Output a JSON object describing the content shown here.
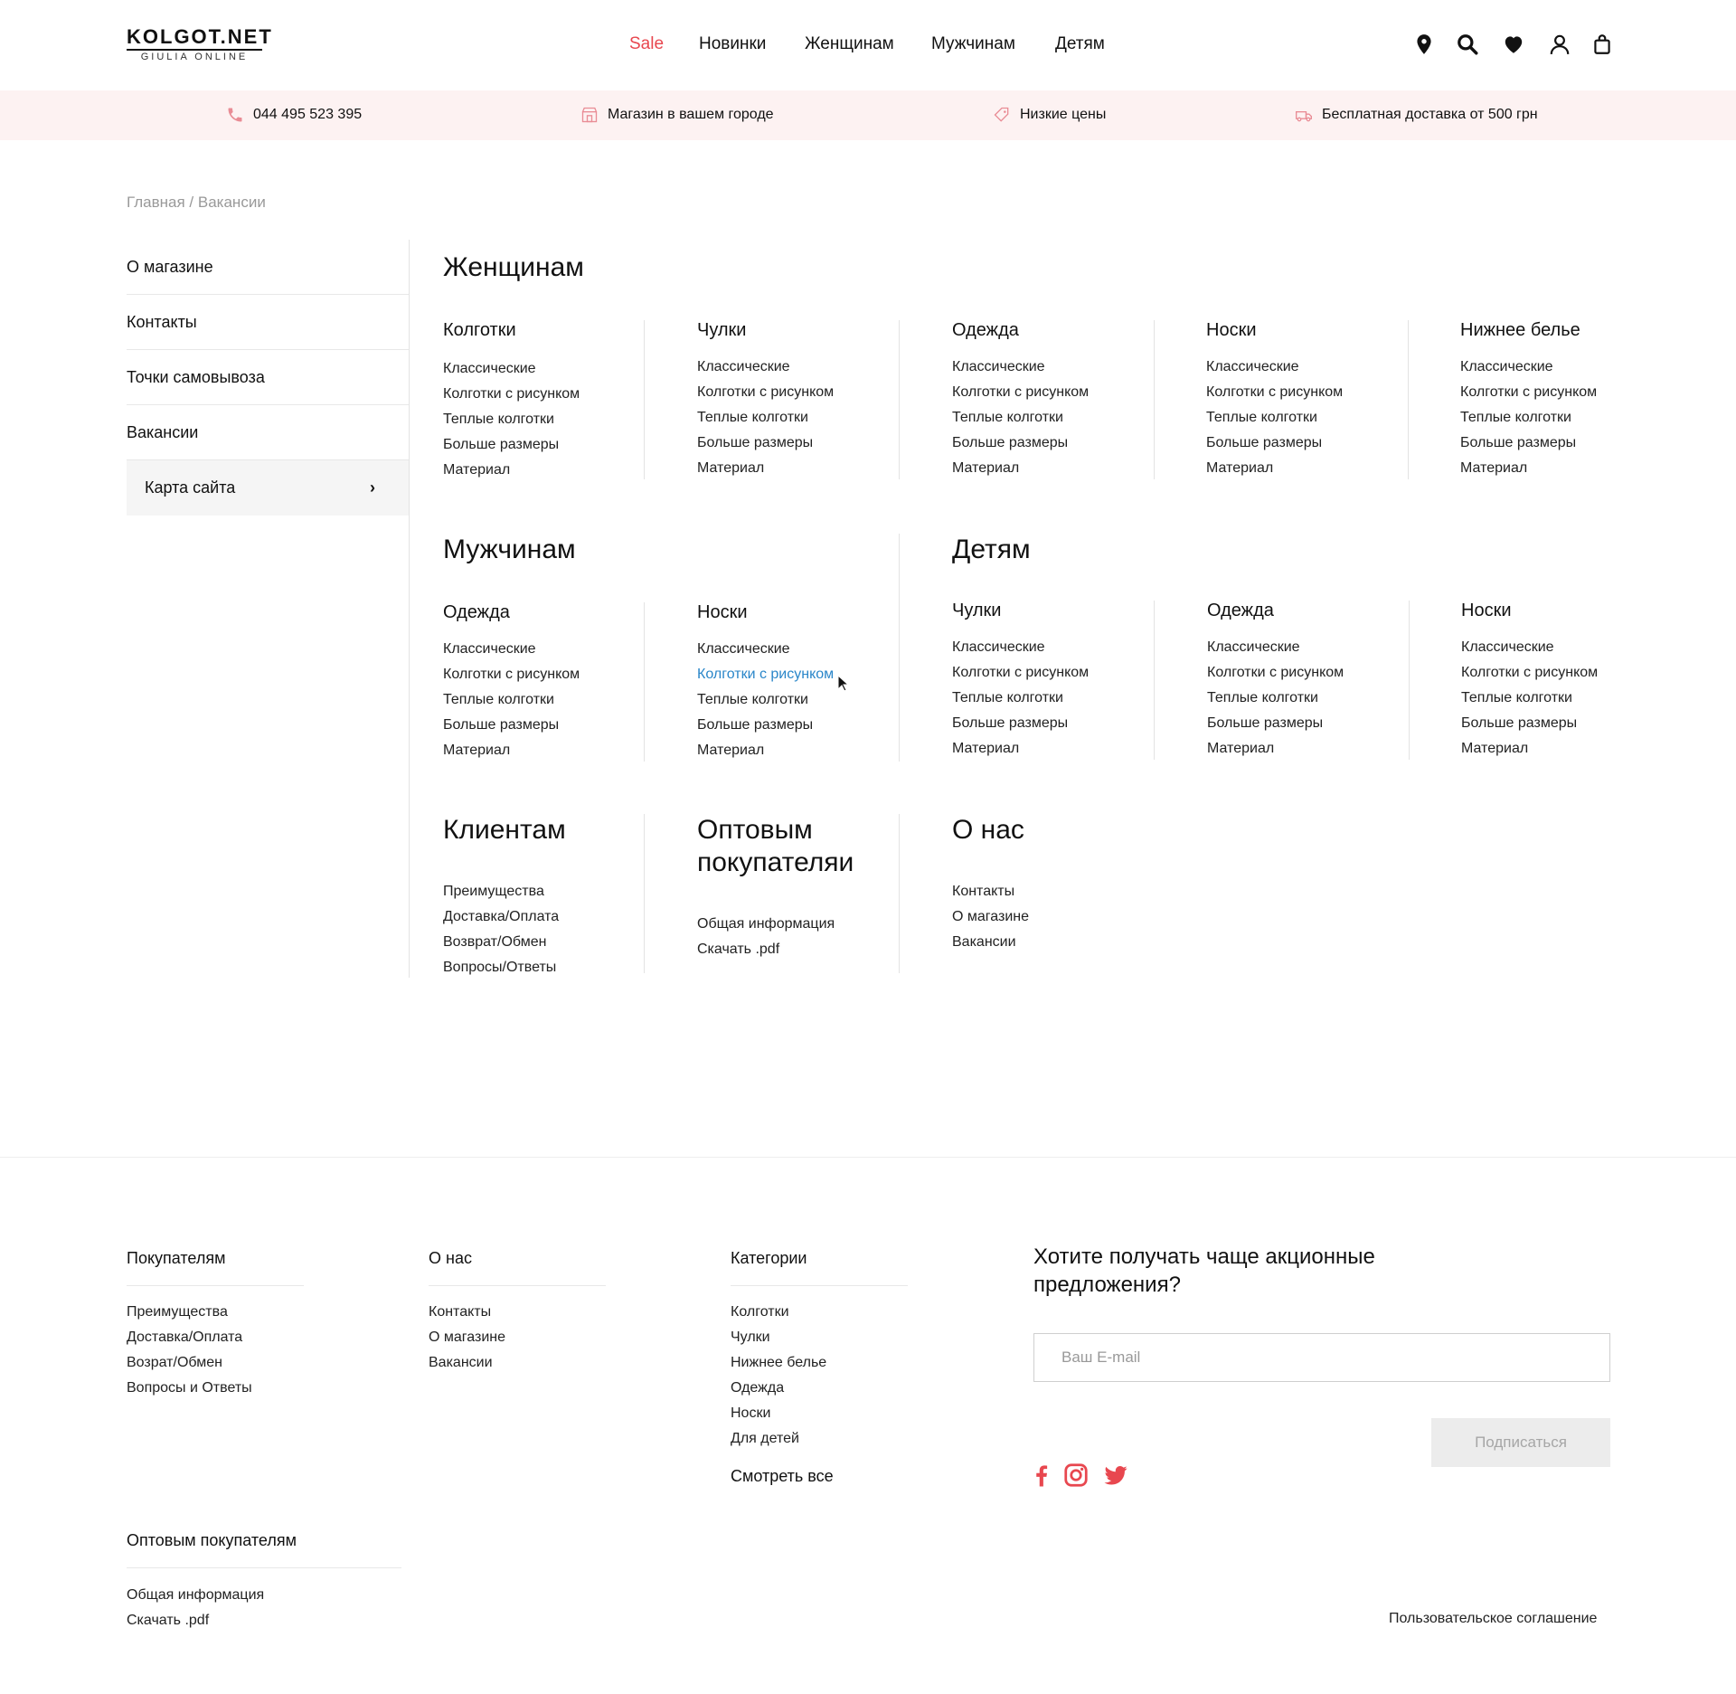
{
  "header": {
    "logo_main": "KOLGOT.NET",
    "logo_sub": "GIULIA ONLINE",
    "nav": [
      "Sale",
      "Новинки",
      "Женщинам",
      "Мужчинам",
      "Детям"
    ],
    "icons": [
      "location-icon",
      "search-icon",
      "heart-icon",
      "user-icon",
      "bag-icon"
    ]
  },
  "infobar": {
    "phone": "044 495 523 395",
    "store": "Магазин в вашем городе",
    "prices": "Низкие цены",
    "delivery": "Бесплатная доставка от 500 грн"
  },
  "breadcrumb": "Главная / Вакансии",
  "sidebar": {
    "items": [
      "О магазине",
      "Контакты",
      "Точки самовывоза",
      "Вакансии",
      "Карта сайта"
    ],
    "active_chevron": "›"
  },
  "sitemap": {
    "women": {
      "title": "Женщинам",
      "columns": [
        {
          "title": "Колготки",
          "items": [
            "Классические",
            "Колготки с рисунком",
            "Теплые колготки",
            "Больше размеры",
            "Материал"
          ]
        },
        {
          "title": "Чулки",
          "items": [
            "Классические",
            "Колготки с рисунком",
            "Теплые колготки",
            "Больше размеры",
            "Материал"
          ]
        },
        {
          "title": "Одежда",
          "items": [
            "Классические",
            "Колготки с рисунком",
            "Теплые колготки",
            "Больше размеры",
            "Материал"
          ]
        },
        {
          "title": "Носки",
          "items": [
            "Классические",
            "Колготки с рисунком",
            "Теплые колготки",
            "Больше размеры",
            "Материал"
          ]
        },
        {
          "title": "Нижнее белье",
          "items": [
            "Классические",
            "Колготки с рисунком",
            "Теплые колготки",
            "Больше размеры",
            "Материал"
          ]
        }
      ]
    },
    "men": {
      "title": "Мужчинам",
      "columns": [
        {
          "title": "Одежда",
          "items": [
            "Классические",
            "Колготки с рисунком",
            "Теплые колготки",
            "Больше размеры",
            "Материал"
          ]
        },
        {
          "title": "Носки",
          "items": [
            "Классические",
            "Колготки с рисунком",
            "Теплые колготки",
            "Больше размеры",
            "Материал"
          ]
        }
      ]
    },
    "kids": {
      "title": "Детям",
      "columns": [
        {
          "title": "Чулки",
          "items": [
            "Классические",
            "Колготки с рисунком",
            "Теплые колготки",
            "Больше размеры",
            "Материал"
          ]
        },
        {
          "title": "Одежда",
          "items": [
            "Классические",
            "Колготки с рисунком",
            "Теплые колготки",
            "Больше размеры",
            "Материал"
          ]
        },
        {
          "title": "Носки",
          "items": [
            "Классические",
            "Колготки с рисунком",
            "Теплые колготки",
            "Больше размеры",
            "Материал"
          ]
        }
      ]
    },
    "clients": {
      "title": "Клиентам",
      "items": [
        "Преимущества",
        "Доставка/Оплата",
        "Возврат/Обмен",
        "Вопросы/Ответы"
      ]
    },
    "wholesale": {
      "title_line1": "Оптовым",
      "title_line2": "покупателяи",
      "items": [
        "Общая информация",
        "Скачать .pdf"
      ]
    },
    "about": {
      "title": "О нас",
      "items": [
        "Контакты",
        "О магазине",
        "Вакансии"
      ]
    }
  },
  "footer": {
    "buyers": {
      "title": "Покупателям",
      "items": [
        "Преимущества",
        "Доставка/Оплата",
        "Возрат/Обмен",
        "Вопросы и Ответы"
      ]
    },
    "about": {
      "title": "О нас",
      "items": [
        "Контакты",
        "О магазине",
        "Вакансии"
      ]
    },
    "categories": {
      "title": "Категории",
      "items": [
        "Колготки",
        "Чулки",
        "Нижнее белье",
        "Одежда",
        "Носки",
        "Для детей"
      ],
      "see_all": "Смотреть все"
    },
    "wholesale": {
      "title": "Оптовым покупателям",
      "items": [
        "Общая информация",
        "Скачать .pdf"
      ]
    },
    "subscribe": {
      "title": "Хотите получать чаще акционные предложения?",
      "placeholder": "Ваш E-mail",
      "button": "Подписаться"
    },
    "social": [
      "facebook-icon",
      "instagram-icon",
      "twitter-icon"
    ],
    "terms": "Пользовательское соглашение"
  },
  "colors": {
    "accent": "#e8474f",
    "link_hover": "#2a86c9",
    "infobar_bg": "#fdf2f2"
  }
}
